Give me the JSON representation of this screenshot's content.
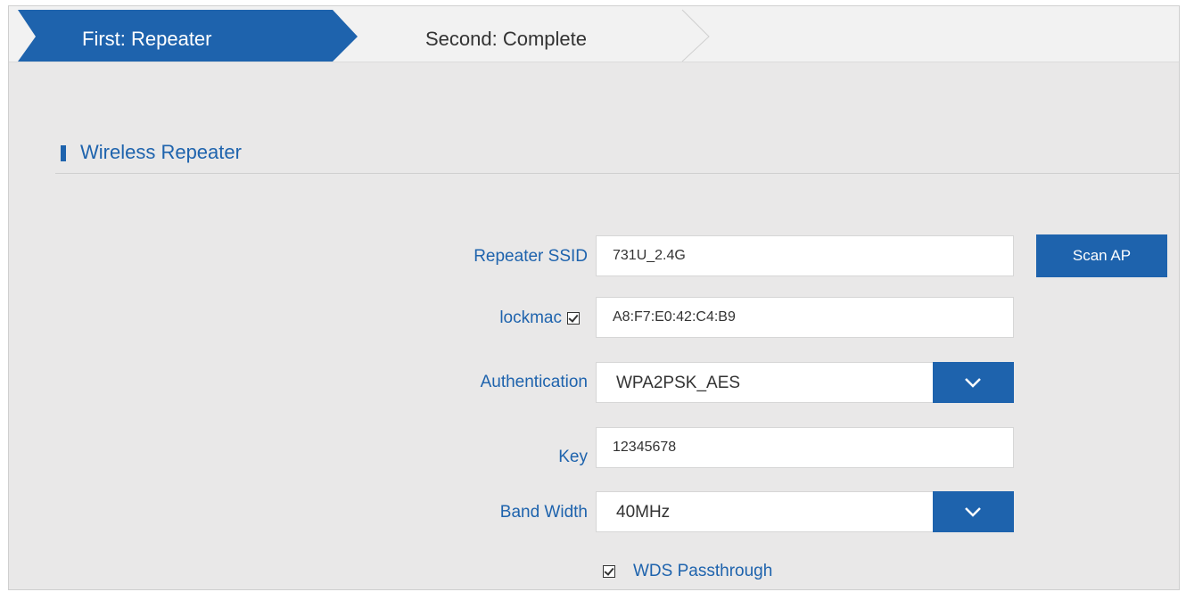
{
  "wizard": {
    "steps": [
      {
        "label": "First: Repeater",
        "active": true
      },
      {
        "label": "Second: Complete",
        "active": false
      }
    ],
    "active_color": "#1e63ad"
  },
  "section": {
    "title": "Wireless Repeater"
  },
  "form": {
    "ssid": {
      "label": "Repeater SSID",
      "value": "731U_2.4G"
    },
    "scan_button": "Scan AP",
    "lockmac": {
      "label": "lockmac",
      "checked": true,
      "value": "A8:F7:E0:42:C4:B9"
    },
    "authentication": {
      "label": "Authentication",
      "value": "WPA2PSK_AES"
    },
    "key": {
      "label": "Key",
      "value": "12345678"
    },
    "bandwidth": {
      "label": "Band Width",
      "value": "40MHz"
    },
    "wds": {
      "label": "WDS Passthrough",
      "checked": true
    }
  },
  "icons": {
    "select_arrow": "chevron-down-icon",
    "section_marker": "section-marker-icon",
    "checkbox": "checkbox-checked-icon"
  }
}
